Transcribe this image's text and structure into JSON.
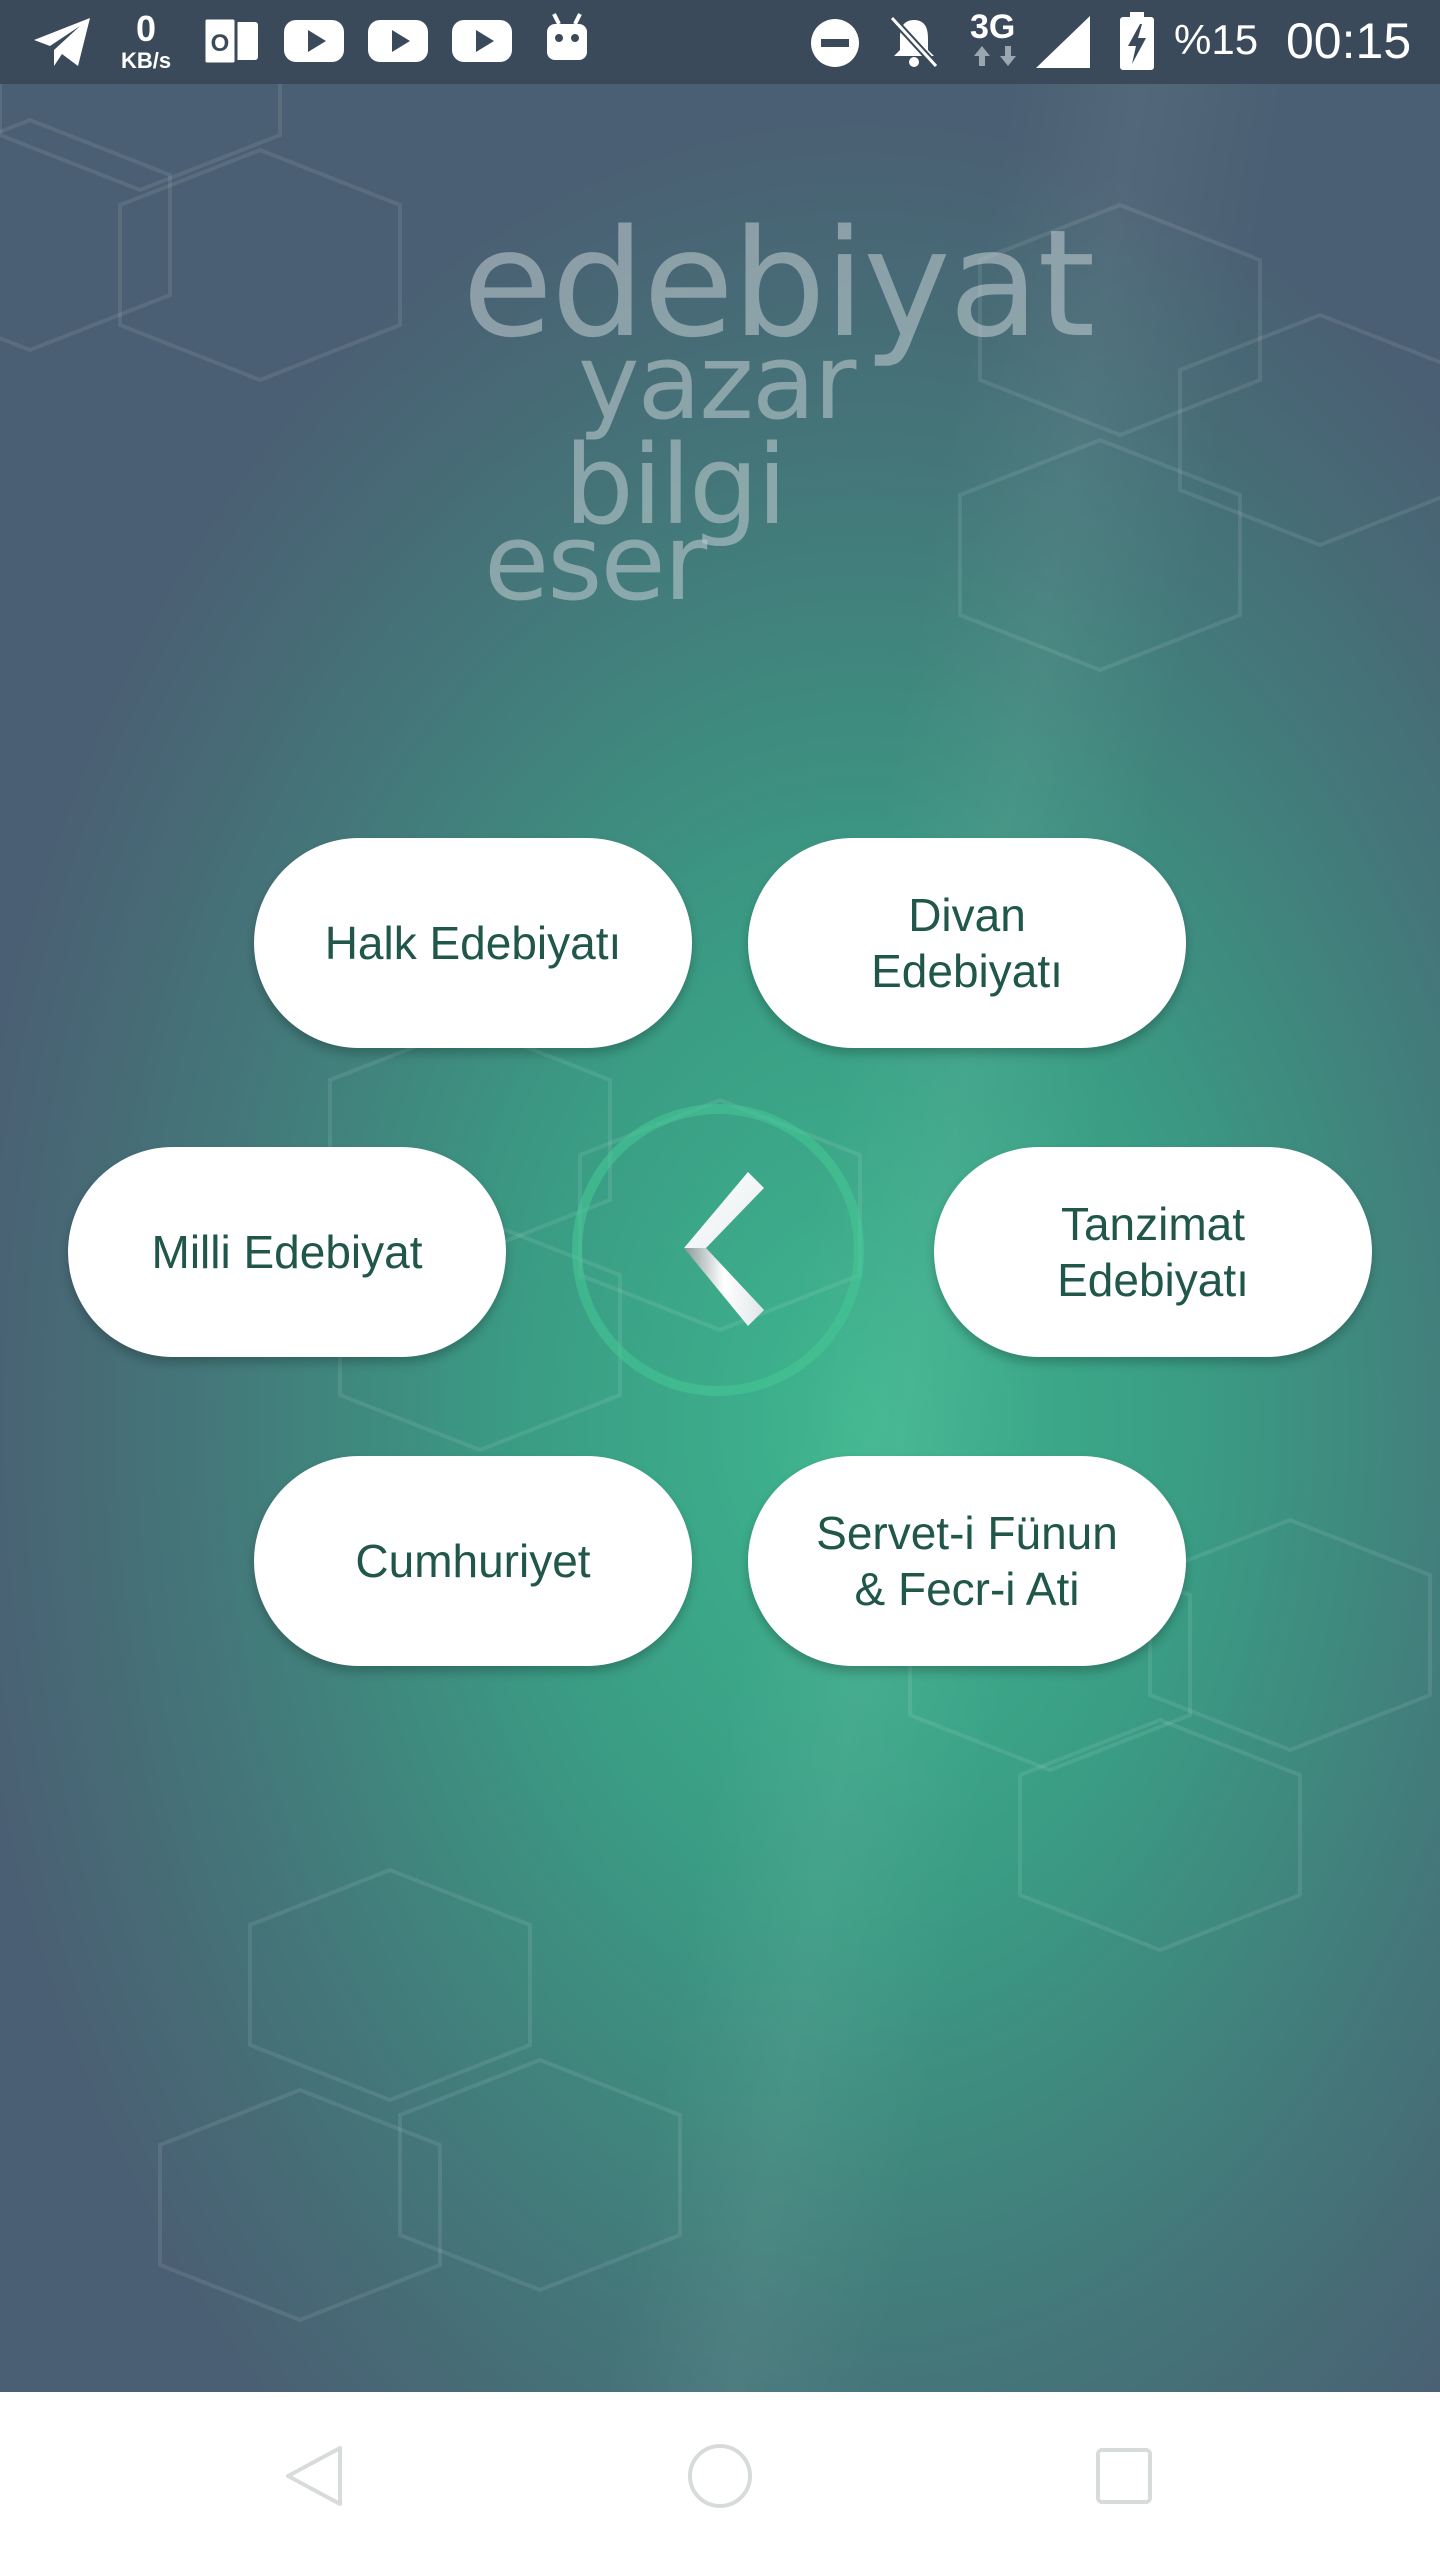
{
  "status_bar": {
    "network_speed_value": "0",
    "network_speed_unit": "KB/s",
    "network_type": "3G",
    "battery_percent": "%15",
    "time": "00:15",
    "icons": [
      "telegram-icon",
      "outlook-icon",
      "youtube-icon",
      "youtube-icon",
      "youtube-icon",
      "android-icon",
      "do-not-disturb-icon",
      "notifications-off-icon",
      "signal-icon",
      "battery-charging-icon"
    ]
  },
  "logo": {
    "word1": "edebiyat",
    "word2": "yazar",
    "word3": "bilgi",
    "word4": "eser"
  },
  "menu": {
    "halk": "Halk Edebiyatı",
    "divan_line1": "Divan",
    "divan_line2": "Edebiyatı",
    "milli": "Milli Edebiyat",
    "tanzimat_line1": "Tanzimat",
    "tanzimat_line2": "Edebiyatı",
    "cumhuriyet": "Cumhuriyet",
    "servet_line1": "Servet-i Fünun",
    "servet_line2": "& Fecr-i Ati"
  },
  "center_button": {
    "icon": "chevron-left-icon"
  },
  "nav_bar": {
    "icons": [
      "nav-back-icon",
      "nav-home-icon",
      "nav-recents-icon"
    ]
  },
  "colors": {
    "status_bar": "#3b4a5a",
    "gradient_center": "#3eb68e",
    "gradient_edge": "#4a5f73",
    "pill_text": "#20574a",
    "pill_bg": "#ffffff",
    "ring": "#46c896"
  }
}
